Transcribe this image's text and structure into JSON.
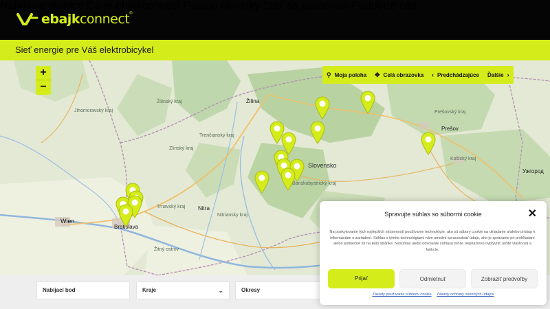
{
  "brand": {
    "logo_text_bold": "ebajk",
    "logo_text_thin": "connect",
    "accent": "#d5ec1b",
    "header_bg": "#050505"
  },
  "nav": [
    "Nabíjacie stanice",
    "Čo je ebajkconnect",
    "Postup",
    "Novinky",
    "Stať sa parnerom",
    "Podporte nás"
  ],
  "tagline": "Sieť energie pre Váš elektrobicykel",
  "map": {
    "zoom_in": "+",
    "zoom_out": "−",
    "tools": [
      {
        "icon": "location-pin-icon",
        "glyph": "⚲",
        "label": "Moja poloha"
      },
      {
        "icon": "fullscreen-icon",
        "glyph": "✥",
        "label": "Celá obrazovka"
      },
      {
        "icon": "chevron-left-icon",
        "glyph": "‹",
        "label": "Predchádzajúce"
      },
      {
        "icon": "chevron-right-icon",
        "glyph": "›",
        "label": "Ďalšie"
      }
    ],
    "labels": {
      "slovensko": "Slovensko",
      "bratislava": "Bratislava",
      "wien": "Wien",
      "presov": "Prešov",
      "nitra": "Nitra",
      "zilina": "Žilina",
      "uzhorod": "Ужгород",
      "zilinsky": "Žilinský kraj",
      "trnavsky": "Trnavský kraj",
      "nitriansky": "Nitriansky kraj",
      "trenciansky": "Trenčiansky kraj",
      "presovsky": "Prešovský kraj",
      "kosicky": "Košický kraj",
      "banskobystricky": "Banskobystrický kraj",
      "zlinsky": "Zlínský kraj",
      "jihomoravsky": "Jihomoravský kraj",
      "zitny": "Žitný ostrov"
    }
  },
  "filters": {
    "point": "Nabíjací bod",
    "region": "Kraje",
    "district": "Okresy"
  },
  "cookie": {
    "title": "Spravujte súhlas so súbormi cookie",
    "body": "Na poskytovanie tých najlepších skúseností používame technológie, ako sú súbory cookie na ukladanie a/alebo prístup k informáciám o zariadení. Súhlas s týmito technológiami nám umožní spracovávať údaje, ako je správanie pri prehliadaní alebo jedinečné ID na tejto stránke. Nesúhlas alebo odvolanie súhlasu môže nepriaznivo ovplyvniť určité vlastnosti a funkcie.",
    "accept": "Prijať",
    "deny": "Odmietnuť",
    "prefs": "Zobraziť predvoľby",
    "link_cookies": "Zásady používania súborov cookie",
    "link_privacy": "Zásady ochrany osobných údajov"
  }
}
